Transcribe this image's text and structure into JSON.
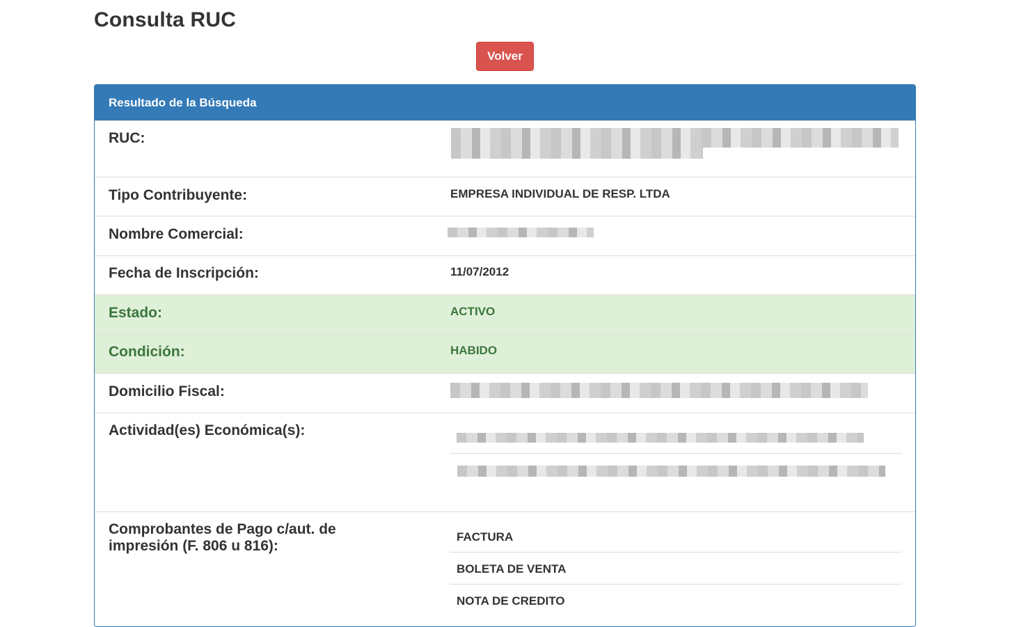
{
  "page": {
    "title": "Consulta RUC",
    "back_button": "Volver"
  },
  "panel": {
    "heading": "Resultado de la Búsqueda"
  },
  "fields": {
    "ruc_label": "RUC:",
    "tipo_label": "Tipo Contribuyente:",
    "tipo_value": "EMPRESA INDIVIDUAL DE RESP. LTDA",
    "nombre_label": "Nombre Comercial:",
    "fecha_label": "Fecha de Inscripción:",
    "fecha_value": "11/07/2012",
    "estado_label": "Estado:",
    "estado_value": "ACTIVO",
    "condicion_label": "Condición:",
    "condicion_value": "HABIDO",
    "domicilio_label": "Domicilio Fiscal:",
    "actividad_label": "Actividad(es) Económica(s):",
    "comprobantes_label_line1": "Comprobantes de Pago c/aut. de",
    "comprobantes_label_line2": "impresión (F. 806 u 816):"
  },
  "comprobantes": [
    "FACTURA",
    "BOLETA DE VENTA",
    "NOTA DE CREDITO"
  ],
  "colors": {
    "primary": "#337ab7",
    "danger": "#d9534f",
    "success_bg": "#dff0d8",
    "success_text": "#3c763d"
  }
}
